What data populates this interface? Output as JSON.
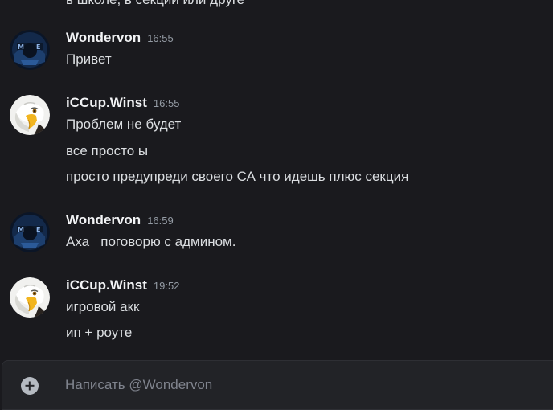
{
  "chat": {
    "partial_top_line": "в школе, в секции или друге",
    "groups": [
      {
        "username": "Wondervon",
        "time": "16:55",
        "avatar": "wondervon-avatar-icon",
        "messages": [
          "Привет"
        ]
      },
      {
        "username": "iCCup.Winst",
        "time": "16:55",
        "avatar": "eagle-avatar-icon",
        "messages": [
          "Проблем не будет",
          "все просто ы",
          "просто предупреди своего СА что идешь плюс секция"
        ]
      },
      {
        "username": "Wondervon",
        "time": "16:59",
        "avatar": "wondervon-avatar-icon",
        "messages": [
          "Аха   поговорю с админом."
        ]
      },
      {
        "username": "iCCup.Winst",
        "time": "19:52",
        "avatar": "eagle-avatar-icon",
        "messages": [
          "игровой акк",
          "ип + роуте"
        ]
      }
    ]
  },
  "composer": {
    "placeholder": "Написать @Wondervon",
    "value": "",
    "add_icon": "plus-circle-icon"
  },
  "colors": {
    "background": "#1a1a1e",
    "composer_bg": "#222327",
    "username": "#f2f3f5",
    "timestamp": "#949ba4",
    "text": "#dbdee1",
    "placeholder": "#80848e"
  }
}
